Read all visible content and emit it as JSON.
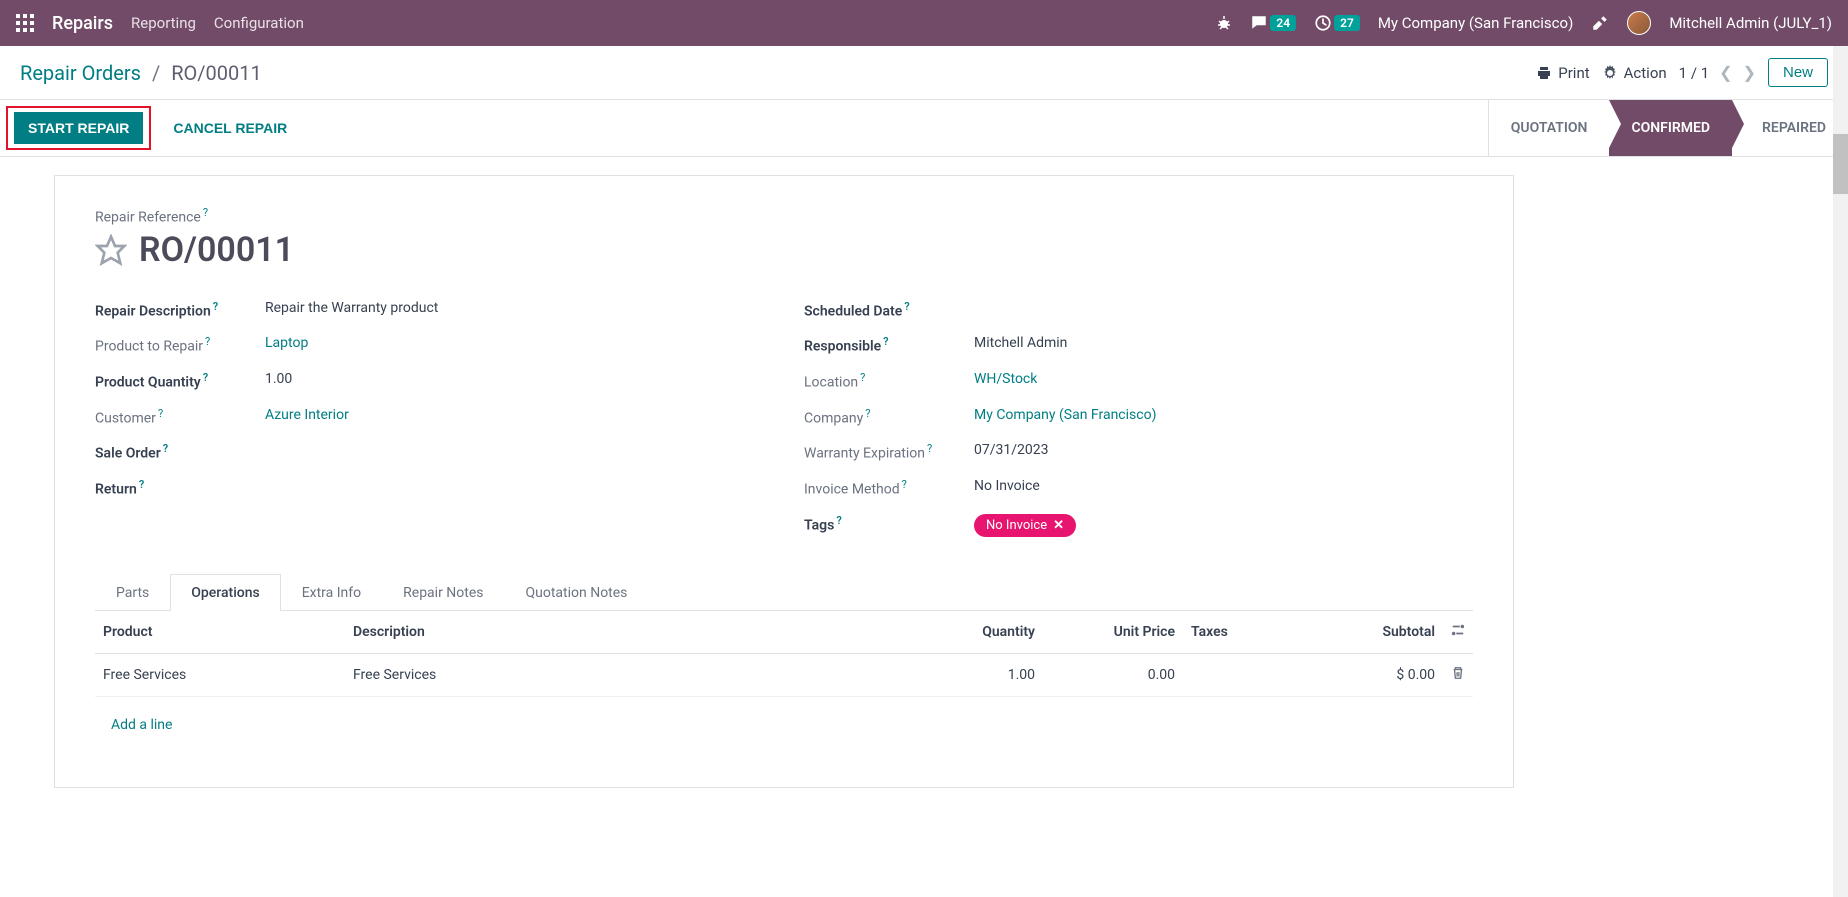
{
  "navbar": {
    "brand": "Repairs",
    "links": [
      "Reporting",
      "Configuration"
    ],
    "msg_badge": "24",
    "clock_badge": "27",
    "company": "My Company (San Francisco)",
    "user": "Mitchell Admin (JULY_1)"
  },
  "breadcrumb": {
    "parent": "Repair Orders",
    "current": "RO/00011"
  },
  "controls": {
    "print": "Print",
    "action": "Action",
    "pager": "1 / 1",
    "new": "New"
  },
  "actions": {
    "start": "START REPAIR",
    "cancel": "CANCEL REPAIR"
  },
  "status": {
    "quotation": "QUOTATION",
    "confirmed": "CONFIRMED",
    "repaired": "REPAIRED"
  },
  "form": {
    "ref_label": "Repair Reference",
    "ref": "RO/00011",
    "left": {
      "repair_desc_label": "Repair Description",
      "repair_desc": "Repair the Warranty  product",
      "product_label": "Product to Repair",
      "product": "Laptop",
      "qty_label": "Product Quantity",
      "qty": "1.00",
      "customer_label": "Customer",
      "customer": "Azure Interior",
      "sale_order_label": "Sale Order",
      "sale_order": "",
      "return_label": "Return",
      "return": ""
    },
    "right": {
      "scheduled_label": "Scheduled Date",
      "scheduled": "",
      "responsible_label": "Responsible",
      "responsible": "Mitchell Admin",
      "location_label": "Location",
      "location": "WH/Stock",
      "company_label": "Company",
      "company": "My Company (San Francisco)",
      "warranty_label": "Warranty Expiration",
      "warranty": "07/31/2023",
      "invoice_method_label": "Invoice Method",
      "invoice_method": "No Invoice",
      "tags_label": "Tags",
      "tag": "No Invoice"
    }
  },
  "tabs": [
    "Parts",
    "Operations",
    "Extra Info",
    "Repair Notes",
    "Quotation Notes"
  ],
  "table": {
    "headers": {
      "product": "Product",
      "desc": "Description",
      "qty": "Quantity",
      "price": "Unit Price",
      "taxes": "Taxes",
      "subtotal": "Subtotal"
    },
    "rows": [
      {
        "product": "Free Services",
        "desc": "Free Services",
        "qty": "1.00",
        "price": "0.00",
        "taxes": "",
        "subtotal": "$ 0.00"
      }
    ],
    "add_line": "Add a line"
  }
}
